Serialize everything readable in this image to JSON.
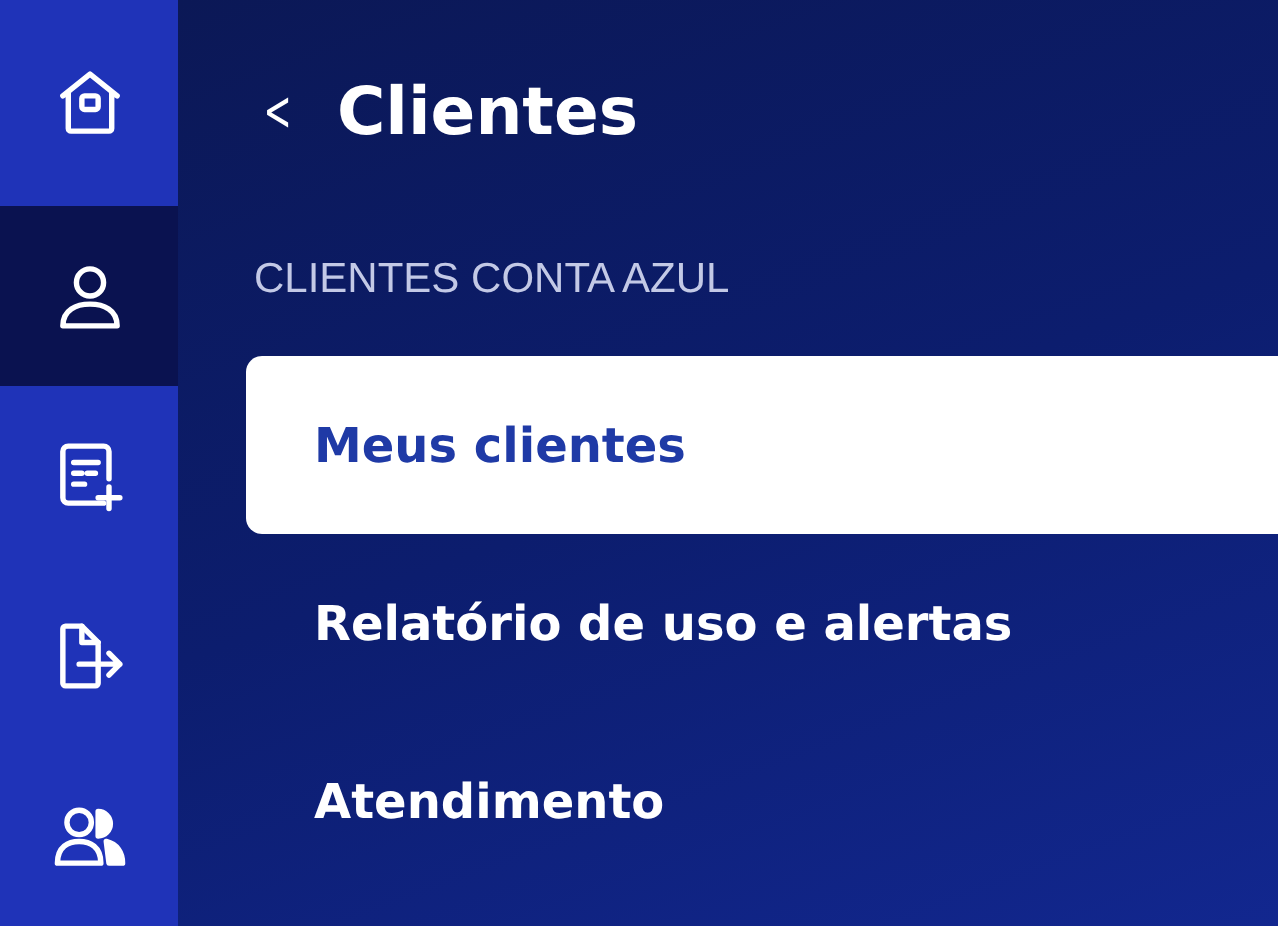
{
  "rail": [
    {
      "kind": "home",
      "selected": false
    },
    {
      "kind": "person",
      "selected": true
    },
    {
      "kind": "doc-add",
      "selected": false
    },
    {
      "kind": "export",
      "selected": false
    },
    {
      "kind": "people",
      "selected": false
    }
  ],
  "header": {
    "back": "<",
    "title": "Clientes"
  },
  "section": "CLIENTES CONTA AZUL",
  "menu": [
    {
      "label": "Meus clientes",
      "selected": true
    },
    {
      "label": "Relatório de uso e alertas",
      "selected": false
    },
    {
      "label": "Atendimento",
      "selected": false
    }
  ]
}
